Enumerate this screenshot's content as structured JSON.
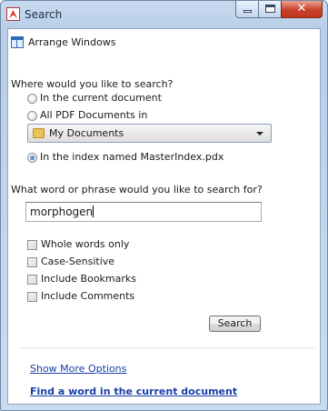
{
  "window": {
    "title": "Search"
  },
  "toolbar": {
    "arrange_label": "Arrange Windows"
  },
  "where": {
    "heading": "Where would you like to search?",
    "option_current": "In the current document",
    "option_all_pdf": "All PDF Documents in",
    "folder_value": "My Documents",
    "option_index": "In the index named MasterIndex.pdx",
    "selected": "index"
  },
  "what": {
    "heading": "What word or phrase would you like to search for?",
    "query": "morphogen"
  },
  "options": {
    "whole_words": "Whole words only",
    "case_sensitive": "Case-Sensitive",
    "include_bookmarks": "Include Bookmarks",
    "include_comments": "Include Comments"
  },
  "actions": {
    "search_label": "Search"
  },
  "links": {
    "more_options": "Show More Options",
    "find_in_doc": "Find a word in the current document"
  },
  "colors": {
    "link": "#1a3ea8",
    "close_button": "#c7412b",
    "radio_selected": "#1d5aa8"
  }
}
